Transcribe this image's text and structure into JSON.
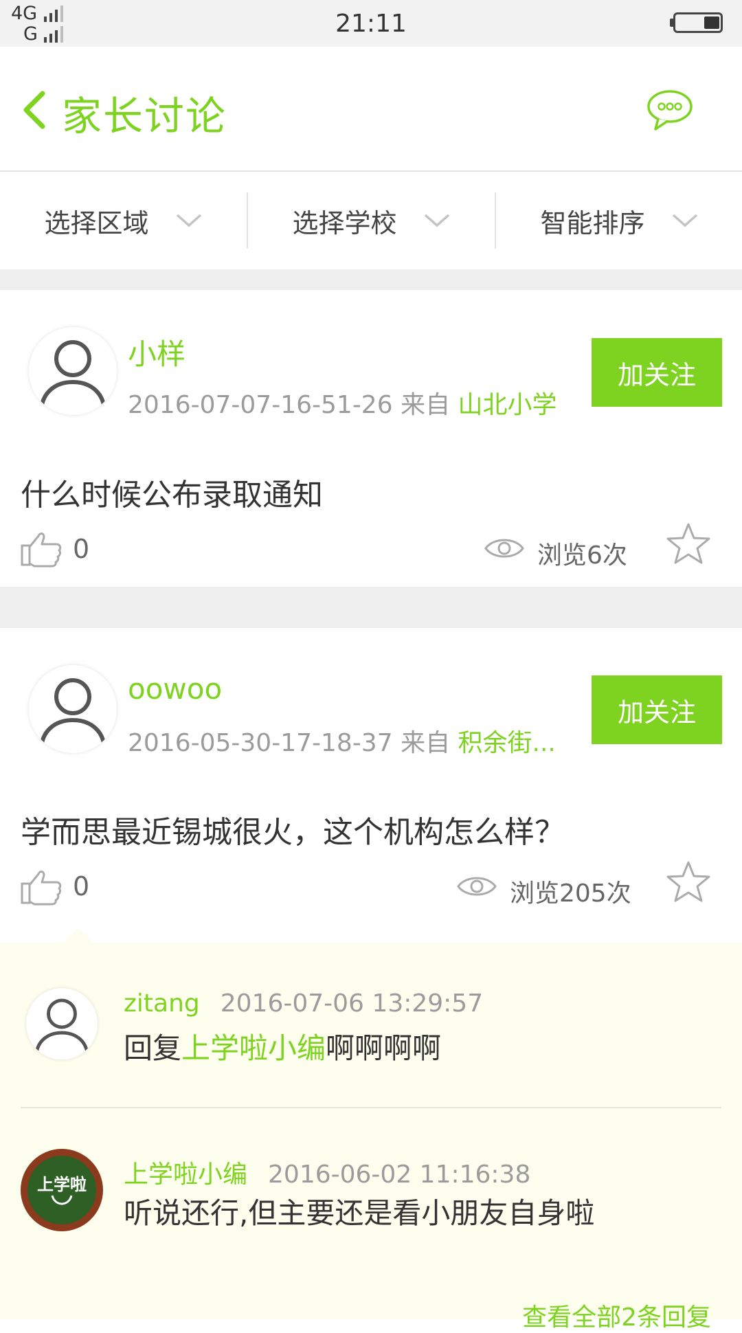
{
  "status_bar": {
    "network_1": "4G",
    "network_2": "G",
    "time": "21:11"
  },
  "header": {
    "title": "家长讨论",
    "back_icon": "chevron-left-icon",
    "chat_icon": "chat-bubble-icon"
  },
  "filters": [
    {
      "label": "选择区域"
    },
    {
      "label": "选择学校"
    },
    {
      "label": "智能排序"
    }
  ],
  "posts": [
    {
      "author": "小样",
      "time": "2016-07-07-16-51-26",
      "from_label": "来自",
      "school": "山北小学",
      "follow_label": "加关注",
      "content": "什么时候公布录取通知",
      "likes": "0",
      "views": "浏览6次"
    },
    {
      "author": "oowoo",
      "time": "2016-05-30-17-18-37",
      "from_label": "来自",
      "school": "积余街...",
      "follow_label": "加关注",
      "content": "学而思最近锡城很火，这个机构怎么样？",
      "likes": "0",
      "views": "浏览205次"
    }
  ],
  "replies": [
    {
      "author": "zitang",
      "time": "2016-07-06 13:29:57",
      "prefix": "回复",
      "mention": "上学啦小编",
      "text": "啊啊啊啊"
    },
    {
      "author": "上学啦小编",
      "time": "2016-06-02 11:16:38",
      "text": "听说还行,但主要还是看小朋友自身啦",
      "avatar_text": "上学啦"
    }
  ],
  "more_replies_label": "查看全部2条回复",
  "colors": {
    "accent": "#7ed321",
    "reply_bg": "#fdfeee",
    "gap_bg": "#efefef"
  }
}
